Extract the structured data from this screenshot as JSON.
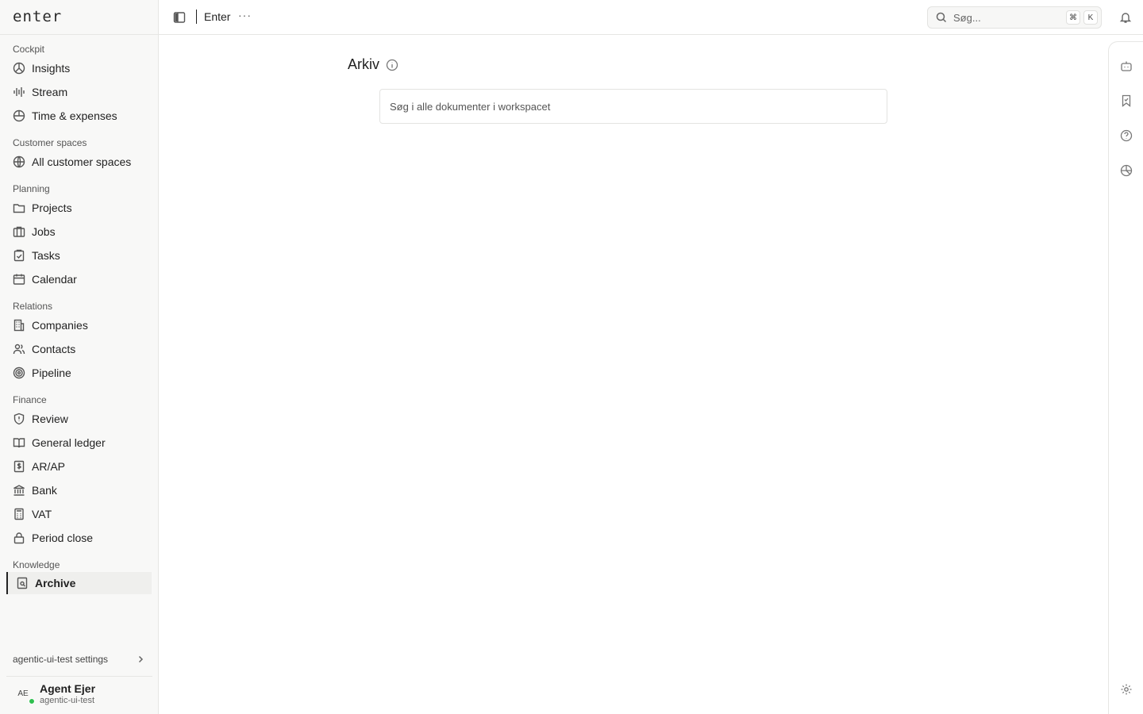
{
  "app": {
    "logo": "enter"
  },
  "topbar": {
    "breadcrumb": "Enter",
    "more": "···",
    "search_placeholder": "Søg...",
    "kbd_cmd": "⌘",
    "kbd_key": "K"
  },
  "sidebar": {
    "sections": [
      {
        "label": "Cockpit",
        "items": [
          {
            "label": "Insights",
            "icon": "insights-icon"
          },
          {
            "label": "Stream",
            "icon": "stream-icon"
          },
          {
            "label": "Time & expenses",
            "icon": "time-expenses-icon"
          }
        ]
      },
      {
        "label": "Customer spaces",
        "items": [
          {
            "label": "All customer spaces",
            "icon": "globe-icon"
          }
        ]
      },
      {
        "label": "Planning",
        "items": [
          {
            "label": "Projects",
            "icon": "folder-icon"
          },
          {
            "label": "Jobs",
            "icon": "briefcase-icon"
          },
          {
            "label": "Tasks",
            "icon": "clipboard-check-icon"
          },
          {
            "label": "Calendar",
            "icon": "calendar-icon"
          }
        ]
      },
      {
        "label": "Relations",
        "items": [
          {
            "label": "Companies",
            "icon": "building-icon"
          },
          {
            "label": "Contacts",
            "icon": "users-icon"
          },
          {
            "label": "Pipeline",
            "icon": "target-icon"
          }
        ]
      },
      {
        "label": "Finance",
        "items": [
          {
            "label": "Review",
            "icon": "shield-icon"
          },
          {
            "label": "General ledger",
            "icon": "book-icon"
          },
          {
            "label": "AR/AP",
            "icon": "dollar-doc-icon"
          },
          {
            "label": "Bank",
            "icon": "bank-icon"
          },
          {
            "label": "VAT",
            "icon": "calculator-icon"
          },
          {
            "label": "Period close",
            "icon": "lock-icon"
          }
        ]
      },
      {
        "label": "Knowledge",
        "items": [
          {
            "label": "Archive",
            "icon": "archive-doc-icon",
            "active": true
          }
        ]
      }
    ],
    "settings_label": "agentic-ui-test settings",
    "user": {
      "initials": "AE",
      "name": "Agent Ejer",
      "workspace": "agentic-ui-test",
      "status_color": "#2fbf4f"
    }
  },
  "main": {
    "title": "Arkiv",
    "search_placeholder": "Søg i alle dokumenter i workspacet"
  },
  "rail": {
    "icons": [
      "bot-icon",
      "bookmark-icon",
      "help-icon",
      "insights-icon",
      "settings-icon"
    ]
  }
}
